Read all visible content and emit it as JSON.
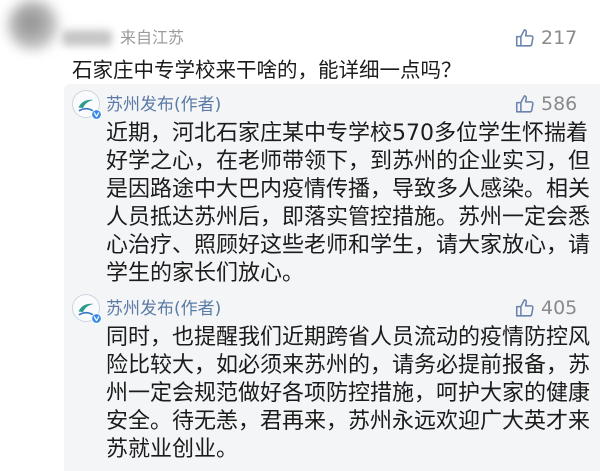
{
  "comment": {
    "location": "来自江苏",
    "likes": 217,
    "text": "石家庄中专学校来干啥的，能详细一点吗？",
    "replies": [
      {
        "author": "苏州发布(作者)",
        "likes": 586,
        "text_lines": [
          "近期，河北石家庄某中专学校570多位学生怀揣着",
          "好学之心，在老师带领下，到苏州的企业实习，但",
          "是因路途中大巴内疫情传播，导致多人感染。相关",
          "人员抵达苏州后，即落实管控措施。苏州一定会悉",
          "心治疗、照顾好这些老师和学生，请大家放心，请",
          "学生的家长们放心。"
        ]
      },
      {
        "author": "苏州发布(作者)",
        "likes": 405,
        "text_lines": [
          "同时，也提醒我们近期跨省人员流动的疫情防控风",
          "险比较大，如必须来苏州的，请务必提前报备，苏",
          "州一定会规范做好各项防控措施，呵护大家的健康",
          "安全。待无恙，君再来，苏州永远欢迎广大英才来",
          "苏就业创业。"
        ]
      }
    ]
  },
  "icons": {
    "like": "thumbs-up-icon",
    "verified": "verified-badge-icon"
  },
  "colors": {
    "text": "#1b1b1b",
    "meta": "#9a9a9a",
    "author": "#5b7ba6",
    "like_icon": "#6c84ad",
    "like_count": "#8a8a8a",
    "reply_background": "#f4f5f7"
  }
}
